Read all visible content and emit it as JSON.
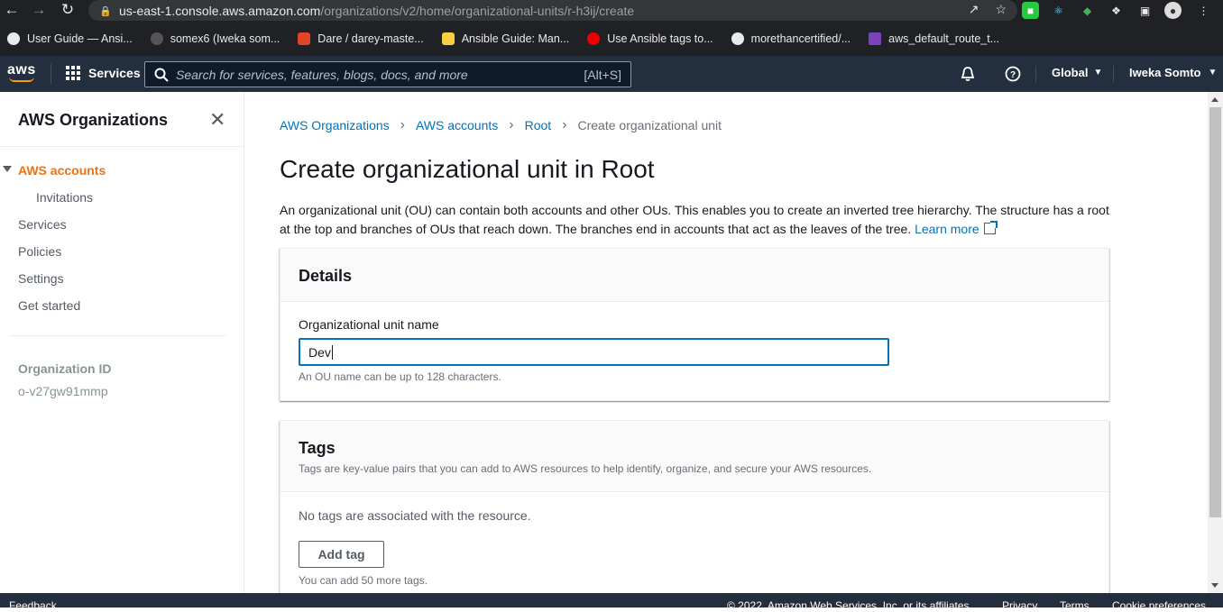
{
  "browser": {
    "url_host": "us-east-1.console.aws.amazon.com",
    "url_path": "/organizations/v2/home/organizational-units/r-h3ij/create",
    "bookmarks": [
      {
        "label": "User Guide — Ansi...",
        "color": "#e8eaed"
      },
      {
        "label": "somex6 (Iweka som...",
        "color": "#444"
      },
      {
        "label": "Dare / darey-maste...",
        "color": "#e24329"
      },
      {
        "label": "Ansible Guide: Man...",
        "color": "#f5d142"
      },
      {
        "label": "Use Ansible tags to...",
        "color": "#ee0000"
      },
      {
        "label": "morethancertified/...",
        "color": "#e8eaed"
      },
      {
        "label": "aws_default_route_t...",
        "color": "#7b42bc"
      }
    ]
  },
  "topnav": {
    "logo": "aws",
    "services_label": "Services",
    "search_placeholder": "Search for services, features, blogs, docs, and more",
    "search_shortcut": "[Alt+S]",
    "region": "Global",
    "user": "Iweka Somto"
  },
  "sidebar": {
    "title": "AWS Organizations",
    "items": [
      {
        "label": "AWS accounts",
        "active": true
      },
      {
        "label": "Invitations"
      },
      {
        "label": "Services"
      },
      {
        "label": "Policies"
      },
      {
        "label": "Settings"
      },
      {
        "label": "Get started"
      }
    ],
    "org_id_label": "Organization ID",
    "org_id_value": "o-v27gw91mmp"
  },
  "main": {
    "breadcrumbs": [
      "AWS Organizations",
      "AWS accounts",
      "Root",
      "Create organizational unit"
    ],
    "title": "Create organizational unit in Root",
    "description": "An organizational unit (OU) can contain both accounts and other OUs. This enables you to create an inverted tree hierarchy. The structure has a root at the top and branches of OUs that reach down. The branches end in accounts that act as the leaves of the tree.",
    "learn_more": "Learn more",
    "details": {
      "title": "Details",
      "field_label": "Organizational unit name",
      "field_value": "Dev",
      "field_hint": "An OU name can be up to 128 characters."
    },
    "tags": {
      "title": "Tags",
      "subtitle": "Tags are key-value pairs that you can add to AWS resources to help identify, organize, and secure your AWS resources.",
      "empty": "No tags are associated with the resource.",
      "add_button": "Add tag",
      "hint": "You can add 50 more tags."
    }
  },
  "footer": {
    "feedback": "Feedback",
    "copyright": "© 2022, Amazon Web Services, Inc. or its affiliates.",
    "privacy": "Privacy",
    "terms": "Terms",
    "cookies": "Cookie preferences"
  },
  "colors": {
    "aws_nav": "#232f3e",
    "link": "#0073bb",
    "active": "#ec7211"
  }
}
